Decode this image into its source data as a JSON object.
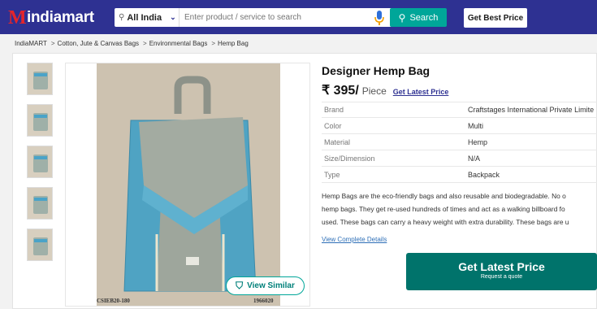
{
  "header": {
    "logo_text": "indiamart",
    "location": "All India",
    "search_placeholder": "Enter product / service to search",
    "search_button": "Search",
    "best_price_button": "Get Best Price"
  },
  "breadcrumb": [
    "IndiaMART",
    "Cotton, Jute & Canvas Bags",
    "Environmental Bags",
    "Hemp Bag"
  ],
  "breadcrumb_sep": ">",
  "product": {
    "title": "Designer Hemp Bag",
    "price": "₹ 395/",
    "unit": "Piece",
    "price_link": "Get Latest Price",
    "specs": [
      {
        "key": "Brand",
        "value": "Craftstages International Private Limite"
      },
      {
        "key": "Color",
        "value": "Multi"
      },
      {
        "key": "Material",
        "value": "Hemp"
      },
      {
        "key": "Size/Dimension",
        "value": "N/A"
      },
      {
        "key": "Type",
        "value": "Backpack"
      }
    ],
    "description_lines": [
      "Hemp Bags are the eco-friendly bags and also reusable and biodegradable. No o",
      "hemp bags. They get re-used hundreds of times and act as a walking billboard fo",
      "used. These bags can carry a heavy weight with extra durability. These bags are u"
    ],
    "details_link": "View Complete Details"
  },
  "cta": {
    "main": "Get Latest Price",
    "sub": "Request a quote"
  },
  "gallery": {
    "view_similar": "View Similar",
    "code_left": "CSIEB20-180",
    "code_right": "1966020"
  },
  "colors": {
    "brand": "#2e3192",
    "teal": "#00a699",
    "cta": "#00736b",
    "logo_red": "#e4252b"
  }
}
